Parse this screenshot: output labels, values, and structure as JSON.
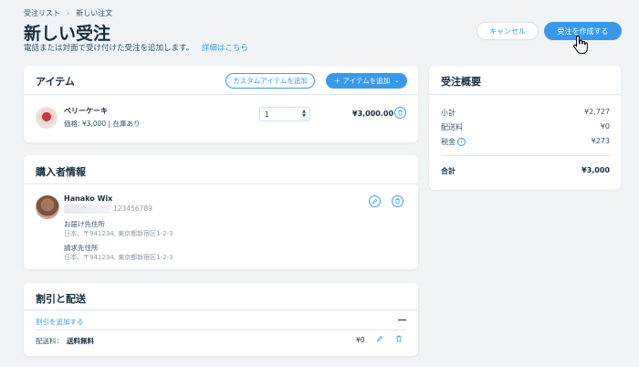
{
  "breadcrumb": {
    "parent": "受注リスト",
    "current": "新しい注文"
  },
  "header": {
    "title": "新しい受注",
    "subtitle": "電話または対面で受け付けた受注を追加します。",
    "details_link": "詳細はこちら",
    "cancel_label": "キャンセル",
    "create_label": "受注を作成する"
  },
  "items": {
    "title": "アイテム",
    "custom_button": "カスタムアイテムを追加",
    "add_button": "＋ アイテムを追加",
    "product": {
      "name": "ベリーケーキ",
      "meta": "価格: ¥3,000 | 在庫あり",
      "quantity": "1",
      "total": "¥3,000.00"
    }
  },
  "buyer": {
    "title": "購入者情報",
    "name": "Hanako Wix",
    "phone": "123456789",
    "shipping_label": "お届け先住所",
    "shipping_address": "日本、〒941234, 東京都新宿区1-2-3",
    "billing_label": "請求先住所",
    "billing_address": "日本、〒941234, 東京都新宿区1-2-3"
  },
  "discount": {
    "title": "割引と配送",
    "add_discount": "割引を追加する",
    "shipping_label": "配送料：",
    "shipping_method": "送料無料",
    "shipping_price": "¥0"
  },
  "summary": {
    "title": "受注概要",
    "subtotal_label": "小計",
    "subtotal": "¥2,727",
    "shipping_label": "配送料",
    "shipping": "¥0",
    "tax_label": "税金",
    "tax": "¥273",
    "total_label": "合計",
    "total": "¥3,000"
  },
  "colors": {
    "accent": "#3899ec",
    "text": "#162d3d",
    "background": "#f0f4f7"
  }
}
